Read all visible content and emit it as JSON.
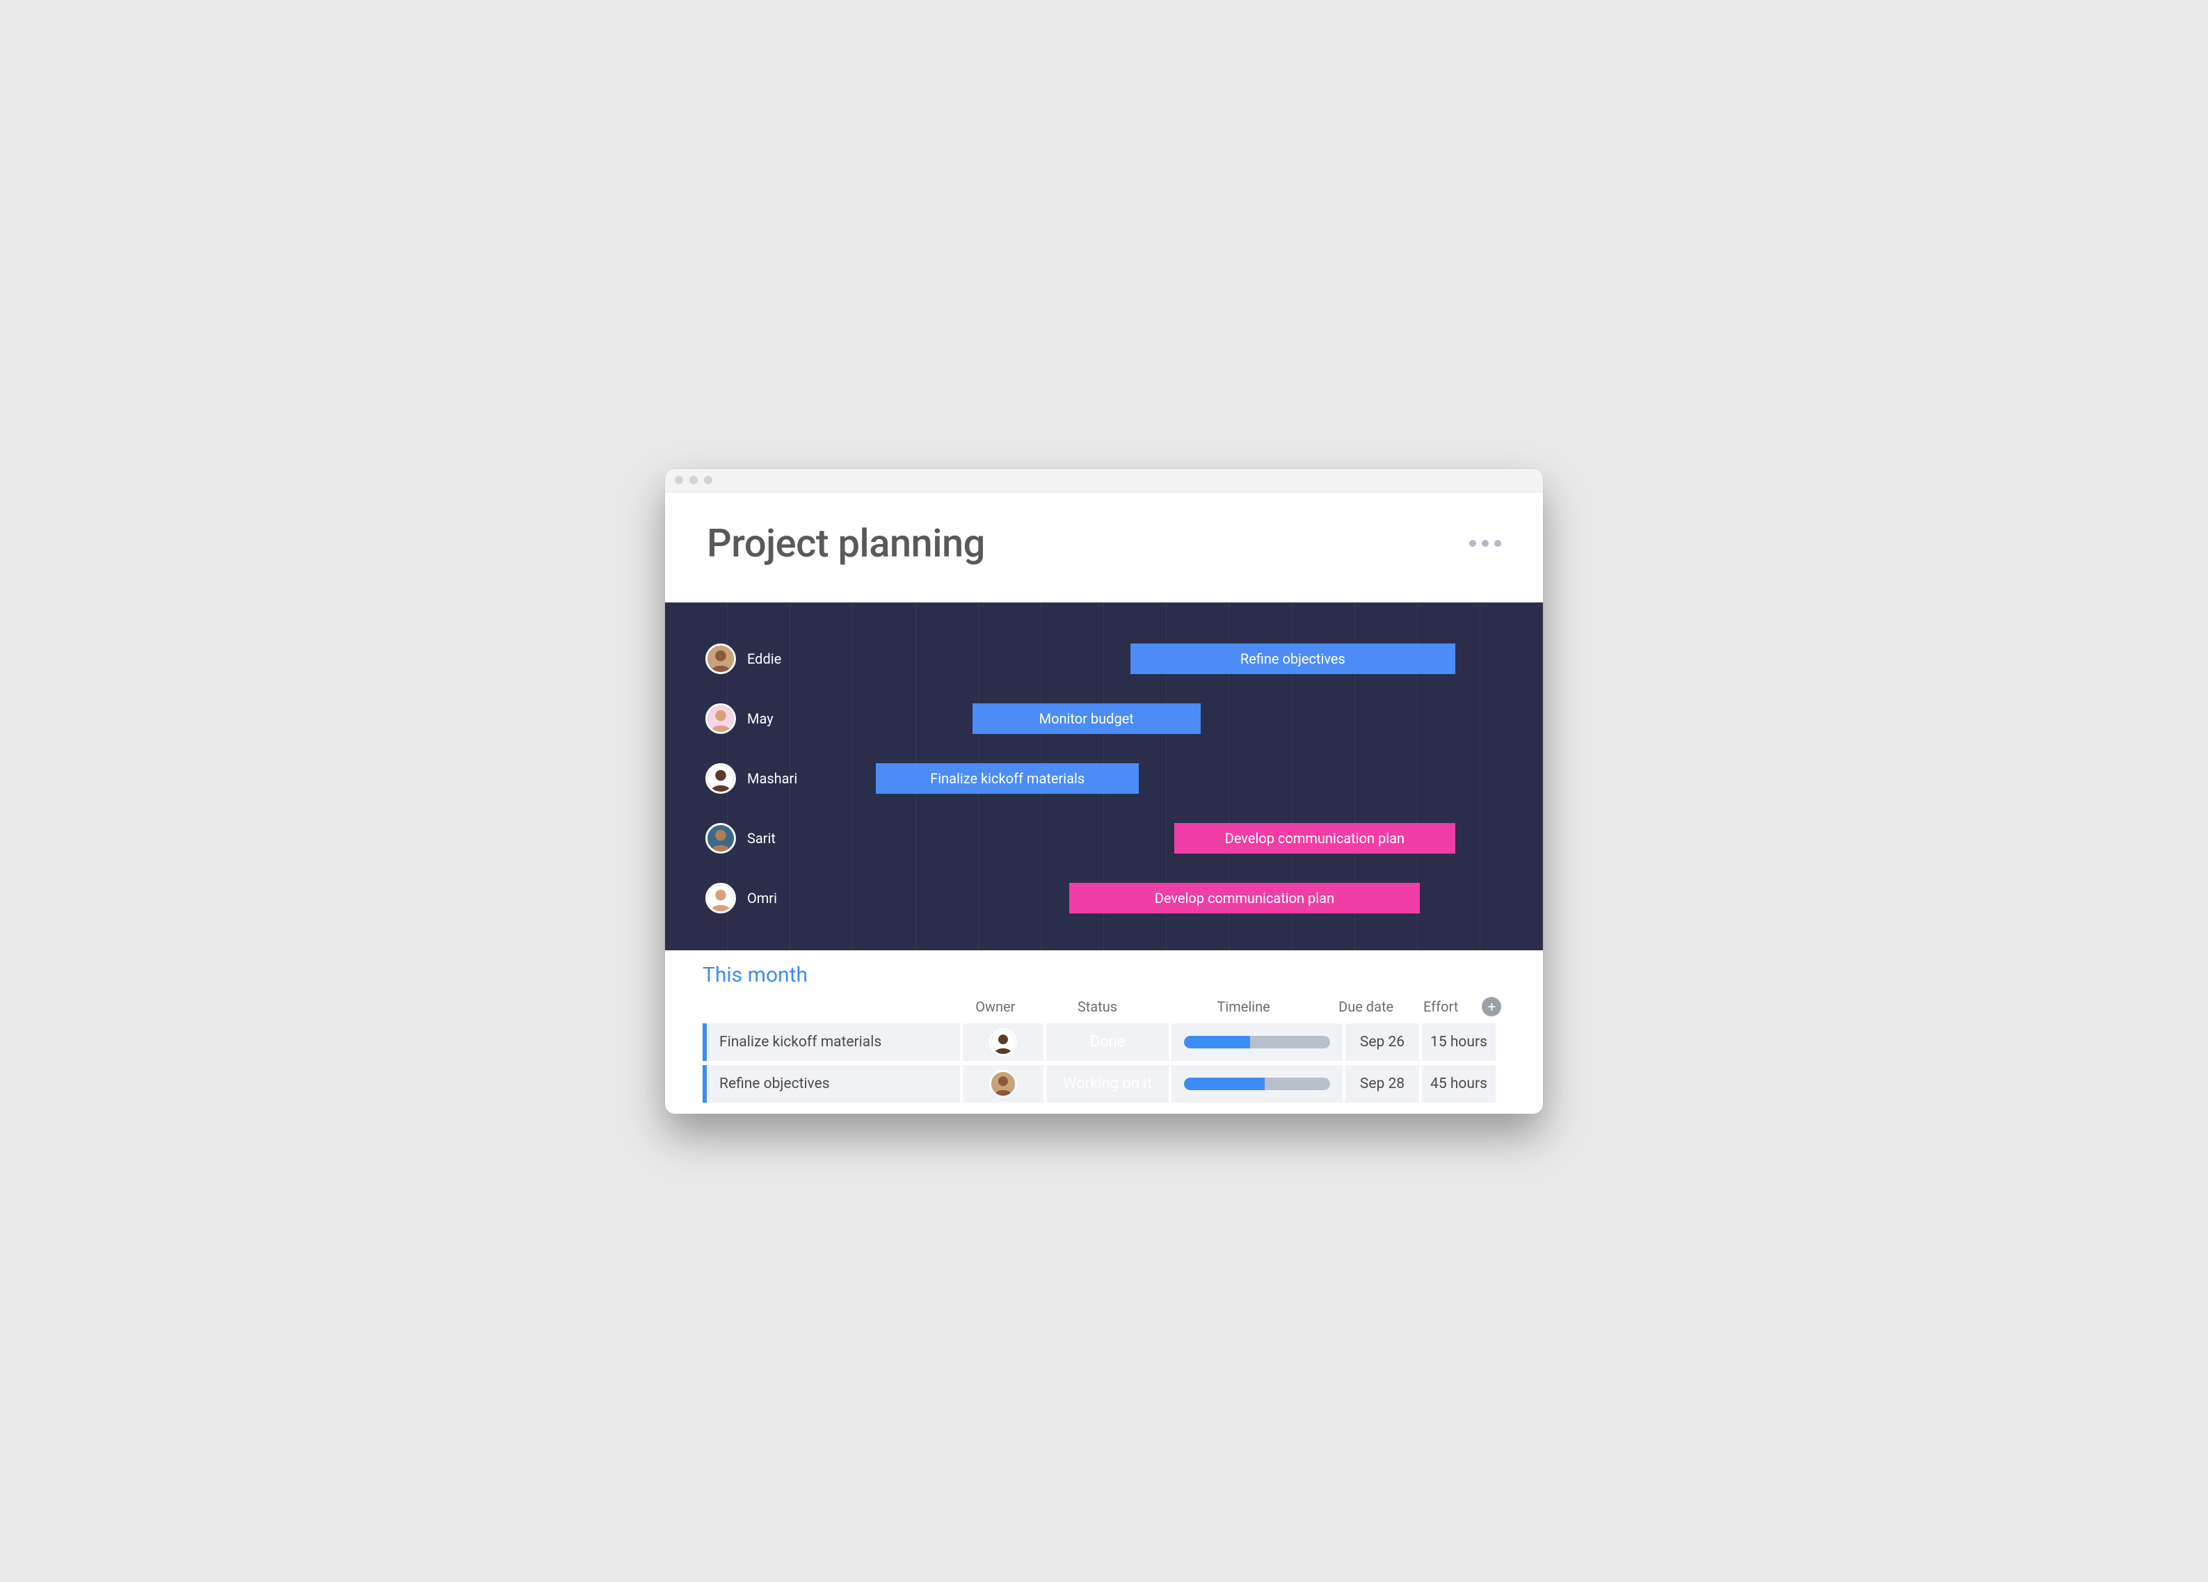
{
  "header": {
    "title": "Project planning"
  },
  "gantt": {
    "rows": [
      {
        "name": "Eddie",
        "bar": {
          "label": "Refine objectives",
          "color": "blue",
          "left_pct": 53,
          "width_pct": 37
        },
        "avatar": {
          "bg": "#c9a27a",
          "skin": "#8a5a3a"
        }
      },
      {
        "name": "May",
        "bar": {
          "label": "Monitor budget",
          "color": "blue",
          "left_pct": 35,
          "width_pct": 26
        },
        "avatar": {
          "bg": "#f5d6e6",
          "skin": "#d9a07a"
        }
      },
      {
        "name": "Mashari",
        "bar": {
          "label": "Finalize kickoff materials",
          "color": "blue",
          "left_pct": 24,
          "width_pct": 30
        },
        "avatar": {
          "bg": "#ffffff",
          "skin": "#5b3b2a"
        }
      },
      {
        "name": "Sarit",
        "bar": {
          "label": "Develop communication plan",
          "color": "pink",
          "left_pct": 58,
          "width_pct": 32
        },
        "avatar": {
          "bg": "#3a6a8a",
          "skin": "#b57b55"
        }
      },
      {
        "name": "Omri",
        "bar": {
          "label": "Develop communication plan",
          "color": "pink",
          "left_pct": 46,
          "width_pct": 40
        },
        "avatar": {
          "bg": "#ffffff",
          "skin": "#d9a07a"
        }
      }
    ]
  },
  "table": {
    "group_title": "This month",
    "columns": {
      "owner": "Owner",
      "status": "Status",
      "timeline": "Timeline",
      "due": "Due date",
      "effort": "Effort"
    },
    "rows": [
      {
        "task": "Finalize kickoff materials",
        "owner_avatar": {
          "bg": "#ffffff",
          "skin": "#5b3b2a"
        },
        "status": {
          "label": "Done",
          "class": "status-done"
        },
        "timeline_fill_pct": 45,
        "due": "Sep 26",
        "effort": "15 hours"
      },
      {
        "task": "Refine objectives",
        "owner_avatar": {
          "bg": "#c9a27a",
          "skin": "#8a5a3a"
        },
        "status": {
          "label": "Working on it",
          "class": "status-working"
        },
        "timeline_fill_pct": 55,
        "due": "Sep 28",
        "effort": "45 hours"
      }
    ]
  }
}
